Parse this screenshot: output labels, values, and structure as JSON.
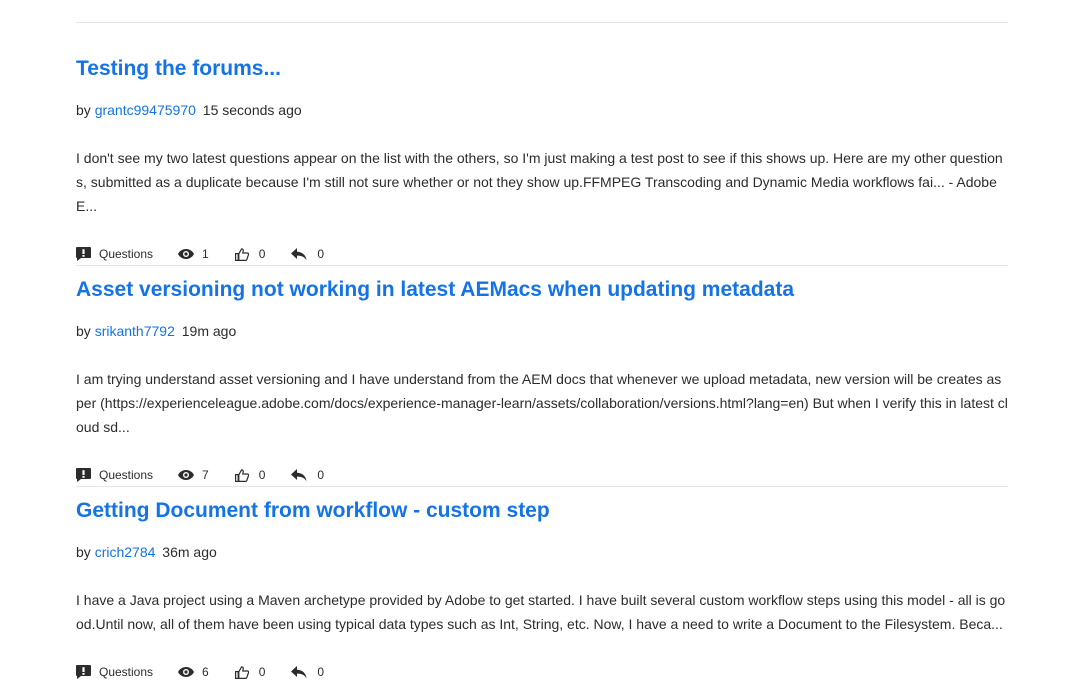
{
  "posts": [
    {
      "title": "Testing the forums...",
      "by": "by",
      "author": "grantc99475970",
      "time": "15 seconds ago",
      "excerpt": "I don't see my two latest questions appear on the list with the others, so I'm just making a test post to see if this shows up. Here are my other questions, submitted as a duplicate because I'm still not sure whether or not they show up.FFMPEG Transcoding and Dynamic Media workflows fai... - Adobe E...",
      "category": "Questions",
      "views": "1",
      "likes": "0",
      "replies": "0"
    },
    {
      "title": "Asset versioning not working in latest AEMacs when updating metadata",
      "by": "by",
      "author": "srikanth7792",
      "time": "19m ago",
      "excerpt": "I am trying understand asset versioning and I have understand from the AEM docs that whenever we upload metadata, new version will be creates as per (https://experienceleague.adobe.com/docs/experience-manager-learn/assets/collaboration/versions.html?lang=en) But when I verify this in latest cloud sd...",
      "category": "Questions",
      "views": "7",
      "likes": "0",
      "replies": "0"
    },
    {
      "title": "Getting Document from workflow - custom step",
      "by": "by",
      "author": "crich2784",
      "time": "36m ago",
      "excerpt": "I have a Java project using a Maven archetype provided by Adobe to get started. I have built several custom workflow steps using this model - all is good.Until now, all of them have been using typical data types such as Int, String, etc. Now, I have a need to write a Document to the Filesystem. Beca...",
      "category": "Questions",
      "views": "6",
      "likes": "0",
      "replies": "0"
    }
  ]
}
